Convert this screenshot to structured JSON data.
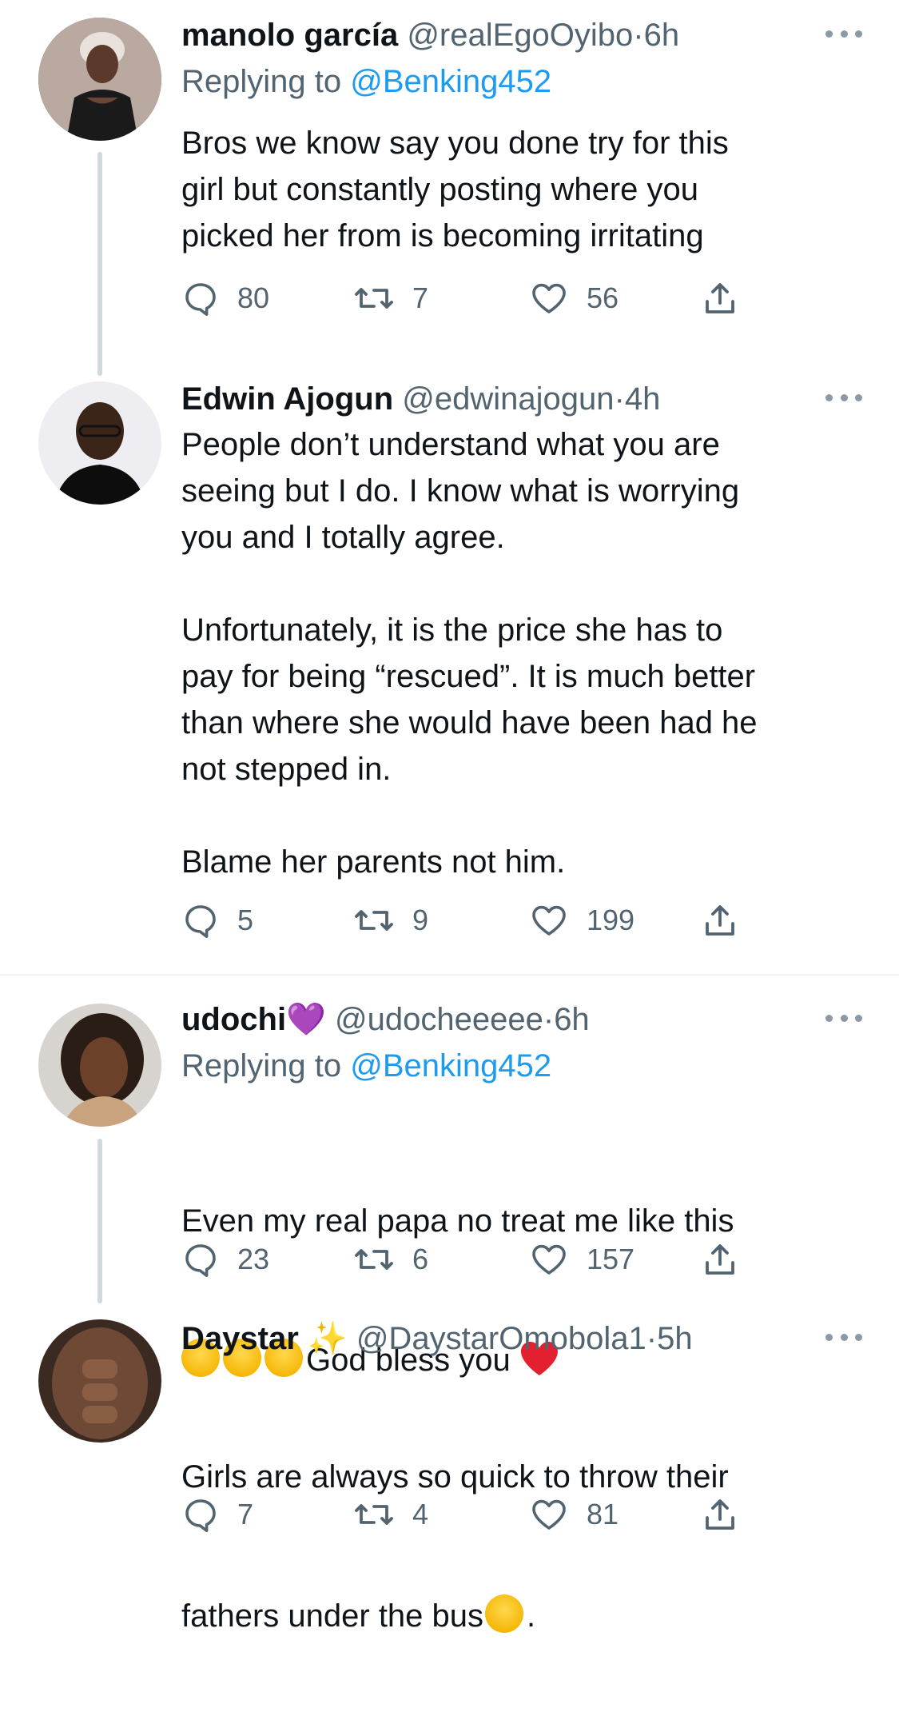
{
  "tweets": [
    {
      "name": "manolo garcía",
      "handle": "@realEgoOyibo",
      "dot": "·",
      "time": "6h",
      "replying_prefix": "Replying to",
      "replying_to": "@Benking452",
      "text": "Bros we know say you done try for this\ngirl but constantly posting where you\npicked her from is becoming irritating",
      "replies": "80",
      "retweets": "7",
      "likes": "56"
    },
    {
      "name": "Edwin Ajogun",
      "handle": "@edwinajogun",
      "dot": "·",
      "time": "4h",
      "text": "People don’t understand what you are\nseeing but I do. I know what is worrying\nyou and I totally agree.\n\nUnfortunately, it is the price she has to\npay for being “rescued”. It is much better\nthan where she would have been had he\nnot stepped in.\n\nBlame her parents not him.",
      "replies": "5",
      "retweets": "9",
      "likes": "199"
    },
    {
      "name": "udochi",
      "name_emoji": "💜",
      "handle": "@udocheeeee",
      "dot": "·",
      "time": "6h",
      "replying_prefix": "Replying to",
      "replying_to": "@Benking452",
      "text_line1": "Even my real papa no treat me like this",
      "text_line2": "God bless you",
      "replies": "23",
      "retweets": "6",
      "likes": "157"
    },
    {
      "name": "Daystar",
      "name_emoji": "✨",
      "handle": "@DaystarOmobola1",
      "dot": "·",
      "time": "5h",
      "text_line1": "Girls are always so quick to throw their",
      "text_line2": "fathers under the bus",
      "text_line2_end": ".",
      "replies": "7",
      "retweets": "4",
      "likes": "81"
    }
  ],
  "icons": {
    "reply": "reply-icon",
    "retweet": "retweet-icon",
    "like": "heart-icon",
    "share": "share-icon",
    "more": "more-icon"
  },
  "colors": {
    "link": "#1d9bf0",
    "secondary": "#536471",
    "thread_line": "#cfd9de"
  }
}
